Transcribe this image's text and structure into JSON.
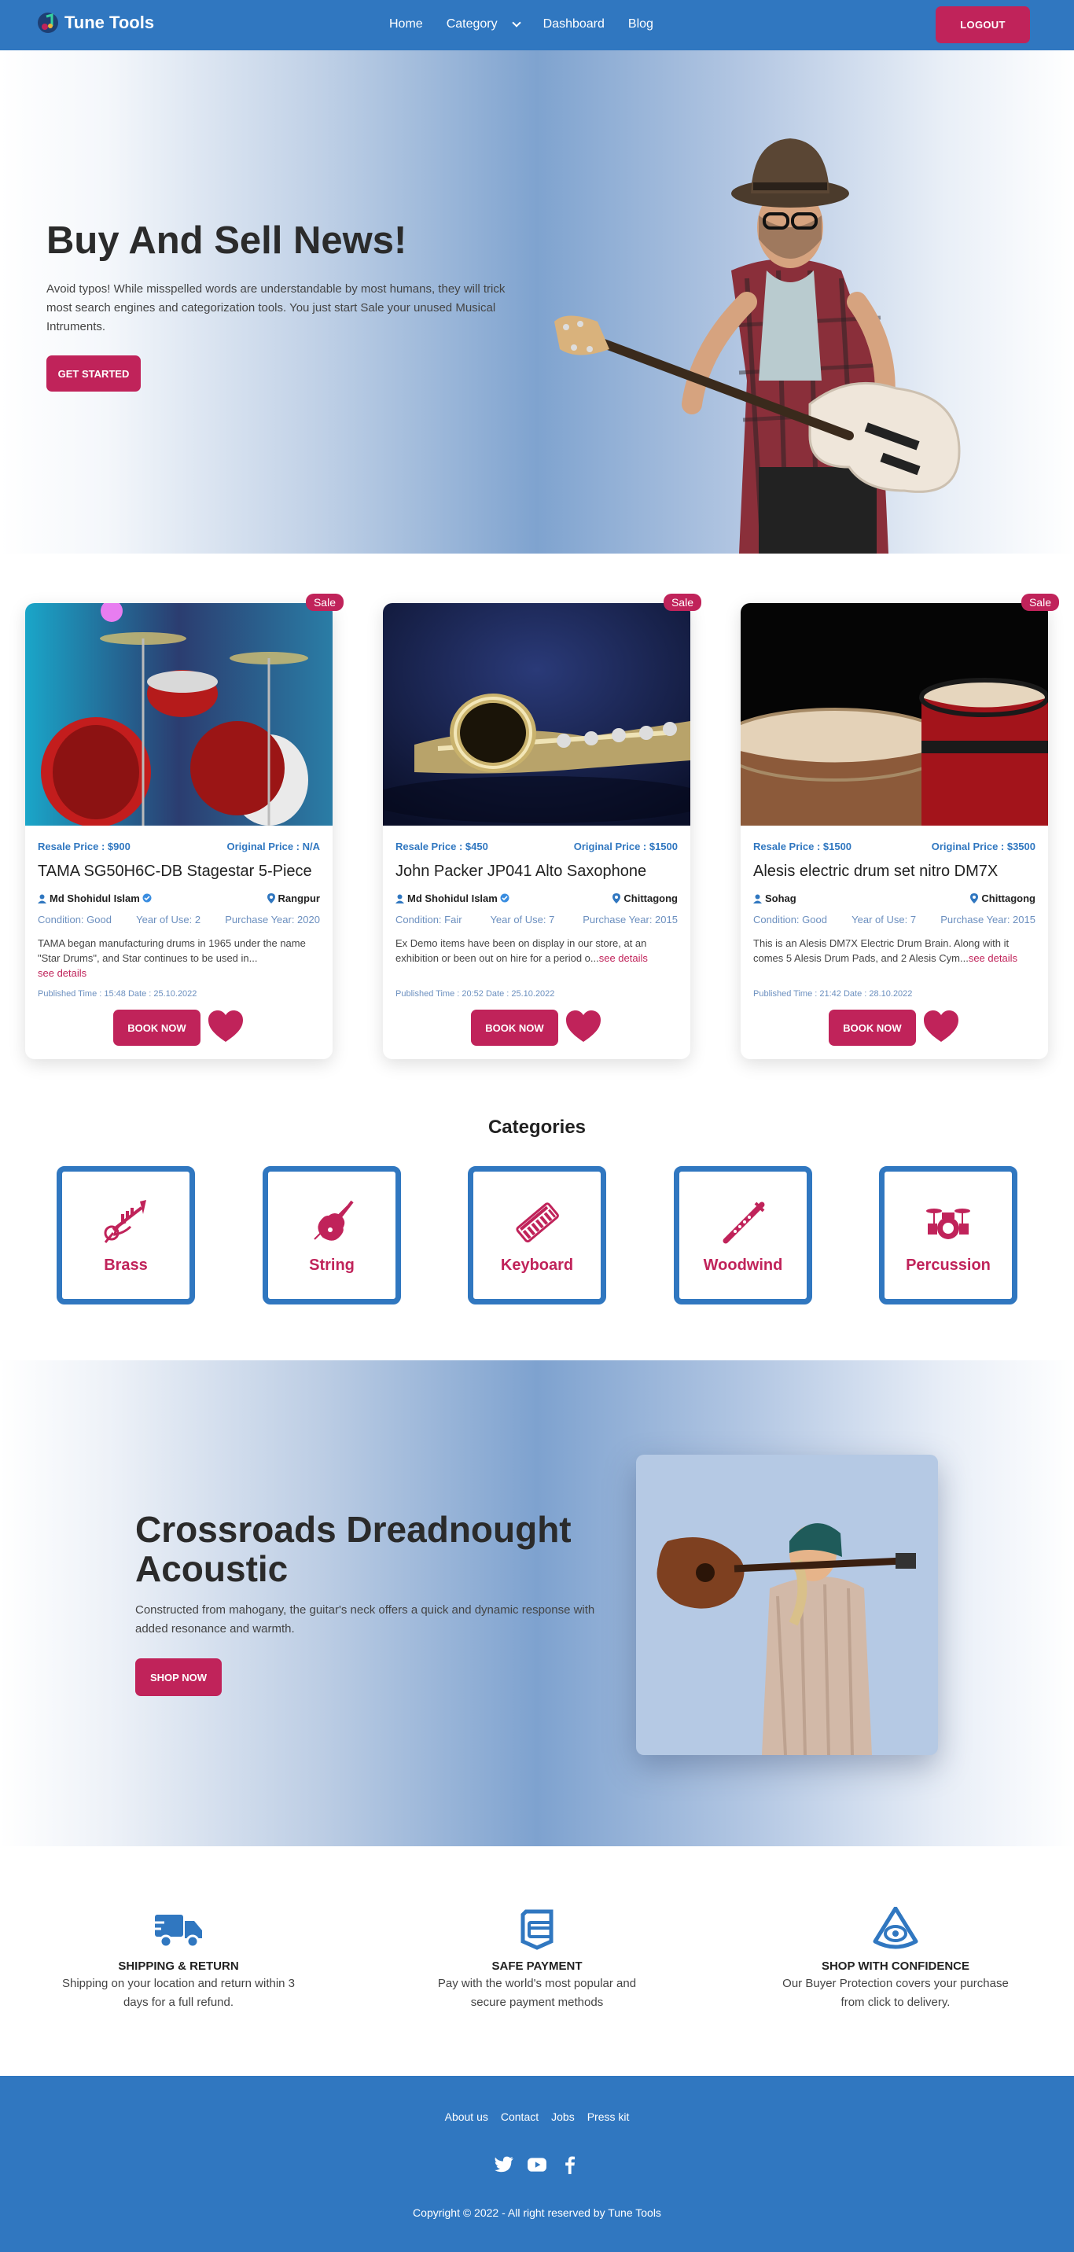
{
  "nav": {
    "brand": "Tune Tools",
    "links": [
      "Home",
      "Category",
      "Dashboard",
      "Blog"
    ],
    "logout": "LOGOUT"
  },
  "hero": {
    "title": "Buy And Sell News!",
    "text": "Avoid typos! While misspelled words are understandable by most humans, they will trick most search engines and categorization tools. You just start Sale your unused Musical Intruments.",
    "button": "GET STARTED"
  },
  "products": [
    {
      "badge": "Sale",
      "resale": "Resale Price : $900",
      "original": "Original Price : N/A",
      "title": "TAMA SG50H6C-DB Stagestar 5-Piece",
      "seller": "Md Shohidul Islam",
      "location": "Rangpur",
      "condition": "Condition: Good",
      "year_of_use": "Year of Use: 2",
      "purchase_year": "Purchase Year: 2020",
      "description": "TAMA began manufacturing drums in 1965 under the name \"Star Drums\", and Star continues to be used in...",
      "see_details": "see details",
      "published": "Published Time : 15:48 Date : 25.10.2022",
      "button": "BOOK NOW"
    },
    {
      "badge": "Sale",
      "resale": "Resale Price : $450",
      "original": "Original Price : $1500",
      "title": "John Packer JP041 Alto Saxophone",
      "seller": "Md Shohidul Islam",
      "location": "Chittagong",
      "condition": "Condition: Fair",
      "year_of_use": "Year of Use: 7",
      "purchase_year": "Purchase Year: 2015",
      "description": "Ex Demo items have been on display in our store, at an exhibition or been out on hire for a period o...",
      "see_details": "see details",
      "published": "Published Time : 20:52 Date : 25.10.2022",
      "button": "BOOK NOW"
    },
    {
      "badge": "Sale",
      "resale": "Resale Price : $1500",
      "original": "Original Price : $3500",
      "title": "Alesis electric drum set nitro DM7X",
      "seller": "Sohag",
      "location": "Chittagong",
      "condition": "Condition: Good",
      "year_of_use": "Year of Use: 7",
      "purchase_year": "Purchase Year: 2015",
      "description": "This is an Alesis DM7X Electric Drum Brain. Along with it comes 5 Alesis Drum Pads, and 2 Alesis Cym...",
      "see_details": "see details",
      "published": "Published Time : 21:42 Date : 28.10.2022",
      "button": "BOOK NOW"
    }
  ],
  "categories": {
    "title": "Categories",
    "items": [
      "Brass",
      "String",
      "Keyboard",
      "Woodwind",
      "Percussion"
    ]
  },
  "promo": {
    "title": "Crossroads Dreadnought Acoustic",
    "text": "Constructed from mahogany, the guitar's neck offers a quick and dynamic response with added resonance and warmth.",
    "button": "SHOP NOW"
  },
  "features": [
    {
      "icon": "truck-icon",
      "title": "SHIPPING & RETURN",
      "text": "Shipping on your location and return within 3 days for a full refund."
    },
    {
      "icon": "card-icon",
      "title": "SAFE PAYMENT",
      "text": "Pay with the world's most popular and secure payment methods"
    },
    {
      "icon": "shield-eye-icon",
      "title": "SHOP WITH CONFIDENCE",
      "text": "Our Buyer Protection covers your purchase from click to delivery."
    }
  ],
  "footer": {
    "links": [
      "About us",
      "Contact",
      "Jobs",
      "Press kit"
    ],
    "socials": [
      "twitter-icon",
      "youtube-icon",
      "facebook-icon"
    ],
    "copyright": "Copyright © 2022 - All right reserved by Tune Tools"
  },
  "colors": {
    "primary": "#3077c0",
    "accent": "#c0235a"
  }
}
